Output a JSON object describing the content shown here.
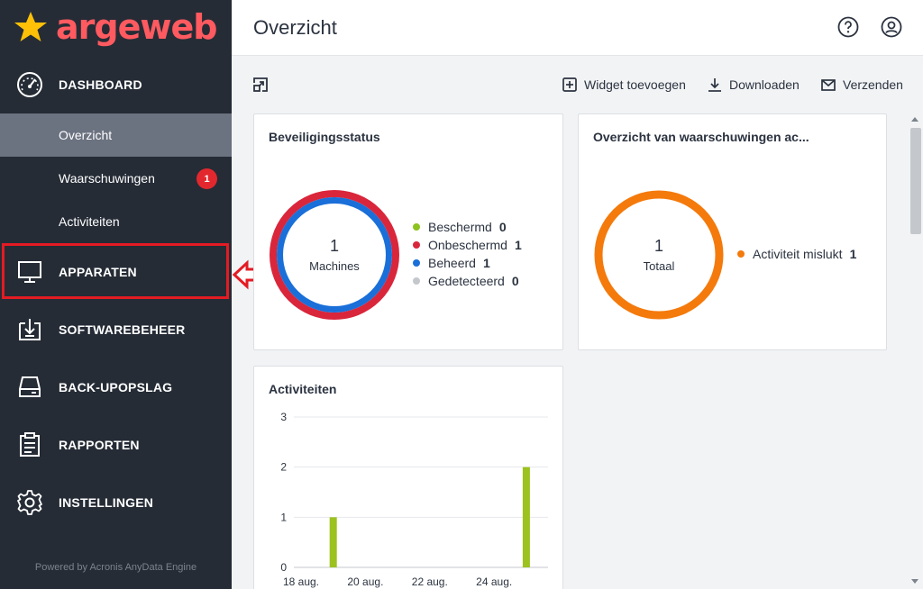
{
  "sidebar": {
    "brand": "argeweb",
    "nav": [
      {
        "label": "DASHBOARD",
        "icon": "speedometer-icon"
      },
      {
        "label": "APPARATEN",
        "icon": "monitor-icon"
      },
      {
        "label": "SOFTWAREBEHEER",
        "icon": "software-download-icon"
      },
      {
        "label": "BACK-UPOPSLAG",
        "icon": "hard-drive-icon"
      },
      {
        "label": "RAPPORTEN",
        "icon": "clipboard-report-icon"
      },
      {
        "label": "INSTELLINGEN",
        "icon": "gear-icon"
      }
    ],
    "sub": [
      {
        "label": "Overzicht",
        "active": true
      },
      {
        "label": "Waarschuwingen",
        "badge": "1"
      },
      {
        "label": "Activiteiten"
      }
    ],
    "powered": "Powered by Acronis AnyData Engine"
  },
  "header": {
    "title": "Overzicht"
  },
  "toolbar": {
    "add_widget": "Widget toevoegen",
    "download": "Downloaden",
    "send": "Verzenden"
  },
  "widgets": {
    "security": {
      "title": "Beveiligingsstatus",
      "center_value": "1",
      "center_label": "Machines",
      "legend": [
        {
          "label": "Beschermd",
          "value": "0",
          "color": "#8dc21f"
        },
        {
          "label": "Onbeschermd",
          "value": "1",
          "color": "#d9263b"
        },
        {
          "label": "Beheerd",
          "value": "1",
          "color": "#1a6fd9"
        },
        {
          "label": "Gedetecteerd",
          "value": "0",
          "color": "#c4c7cc"
        }
      ]
    },
    "alerts": {
      "title": "Overzicht van waarschuwingen ac...",
      "center_value": "1",
      "center_label": "Totaal",
      "legend": [
        {
          "label": "Activiteit mislukt",
          "value": "1",
          "color": "#f47a0c"
        }
      ]
    },
    "activities": {
      "title": "Activiteiten"
    }
  },
  "colors": {
    "sidebar_bg": "#252c36",
    "brand": "#ff5a60",
    "star": "#ffc107",
    "highlight": "#e41b23",
    "bar": "#9cc21f"
  },
  "chart_data": {
    "type": "bar",
    "title": "Activiteiten",
    "x_tick_labels": [
      "18 aug.",
      "20 aug.",
      "22 aug.",
      "24 aug."
    ],
    "y_ticks": [
      0,
      1,
      2,
      3
    ],
    "ylim": [
      0,
      3
    ],
    "x_range": [
      "18 aug.",
      "25 aug."
    ],
    "bars": [
      {
        "x": "19 aug.",
        "value": 1
      },
      {
        "x": "25 aug.",
        "value": 2
      }
    ],
    "grid": true
  }
}
